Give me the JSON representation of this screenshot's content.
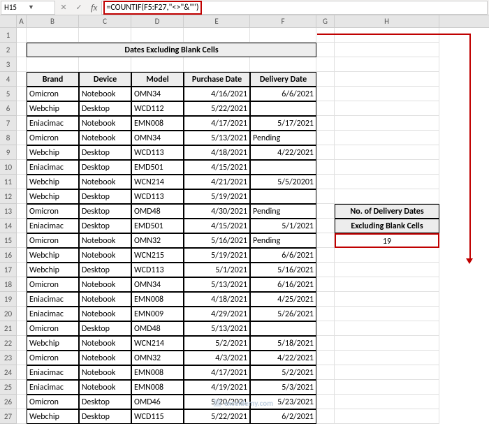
{
  "nameBox": "H15",
  "formula": "=COUNTIF(F5:F27,\"<>\"&\"\")",
  "columns": [
    "A",
    "B",
    "C",
    "D",
    "E",
    "F",
    "G",
    "H"
  ],
  "title": "Dates Excluding Blank Cells",
  "headers": {
    "b": "Brand",
    "c": "Device",
    "d": "Model",
    "e": "Purchase Date",
    "f": "Delivery Date"
  },
  "side": {
    "l1": "No. of Delivery Dates",
    "l2": "Excluding Blank Cells",
    "result": "19"
  },
  "watermark": "exceldemy.com",
  "rows": [
    {
      "b": "Omicron",
      "c": "Notebook",
      "d": "OMN34",
      "e": "4/16/2021",
      "f": "6/6/2021"
    },
    {
      "b": "Webchip",
      "c": "Desktop",
      "d": "WCD112",
      "e": "5/22/2021",
      "f": ""
    },
    {
      "b": "Eniacimac",
      "c": "Notebook",
      "d": "EMN008",
      "e": "4/17/2021",
      "f": "5/17/2021"
    },
    {
      "b": "Omicron",
      "c": "Notebook",
      "d": "OMN34",
      "e": "5/13/2021",
      "f": "Pending"
    },
    {
      "b": "Webchip",
      "c": "Desktop",
      "d": "WCD113",
      "e": "4/18/2021",
      "f": "4/22/2021"
    },
    {
      "b": "Eniacimac",
      "c": "Desktop",
      "d": "EMD501",
      "e": "4/15/2021",
      "f": ""
    },
    {
      "b": "Webchip",
      "c": "Notebook",
      "d": "WCN214",
      "e": "4/21/2021",
      "f": "5/5/20201"
    },
    {
      "b": "Webchip",
      "c": "Desktop",
      "d": "WCD113",
      "e": "5/19/2021",
      "f": ""
    },
    {
      "b": "Omicron",
      "c": "Desktop",
      "d": "OMD48",
      "e": "4/30/2021",
      "f": "Pending"
    },
    {
      "b": "Eniacimac",
      "c": "Desktop",
      "d": "EMD501",
      "e": "4/15/2021",
      "f": "5/1/2021"
    },
    {
      "b": "Omicron",
      "c": "Notebook",
      "d": "OMN32",
      "e": "5/16/2021",
      "f": "Pending"
    },
    {
      "b": "Webchip",
      "c": "Notebook",
      "d": "WCN215",
      "e": "5/19/2021",
      "f": "6/6/2021"
    },
    {
      "b": "Webchip",
      "c": "Desktop",
      "d": "WCD113",
      "e": "5/1/2021",
      "f": "5/16/2021"
    },
    {
      "b": "Omicron",
      "c": "Notebook",
      "d": "OMN34",
      "e": "5/13/2021",
      "f": "6/16/2021"
    },
    {
      "b": "Eniacimac",
      "c": "Notebook",
      "d": "EMN008",
      "e": "4/18/2021",
      "f": "4/25/2021"
    },
    {
      "b": "Eniacimac",
      "c": "Notebook",
      "d": "EMN009",
      "e": "4/29/2021",
      "f": "5/26/2021"
    },
    {
      "b": "Omicron",
      "c": "Desktop",
      "d": "OMD48",
      "e": "5/13/2021",
      "f": ""
    },
    {
      "b": "Webchip",
      "c": "Notebook",
      "d": "WCN214",
      "e": "5/2/2021",
      "f": "5/18/2021"
    },
    {
      "b": "Omicron",
      "c": "Notebook",
      "d": "OMN32",
      "e": "4/3/2021",
      "f": "4/22/2021"
    },
    {
      "b": "Eniacimac",
      "c": "Notebook",
      "d": "EMN008",
      "e": "4/17/2021",
      "f": "5/2/2021"
    },
    {
      "b": "Eniacimac",
      "c": "Notebook",
      "d": "EMN008",
      "e": "4/19/2021",
      "f": "5/3/2021"
    },
    {
      "b": "Omicron",
      "c": "Desktop",
      "d": "OMD46",
      "e": "5/20/2021",
      "f": "5/23/2021"
    },
    {
      "b": "Webchip",
      "c": "Desktop",
      "d": "WCD115",
      "e": "5/22/2021",
      "f": "6/2/2021"
    }
  ]
}
